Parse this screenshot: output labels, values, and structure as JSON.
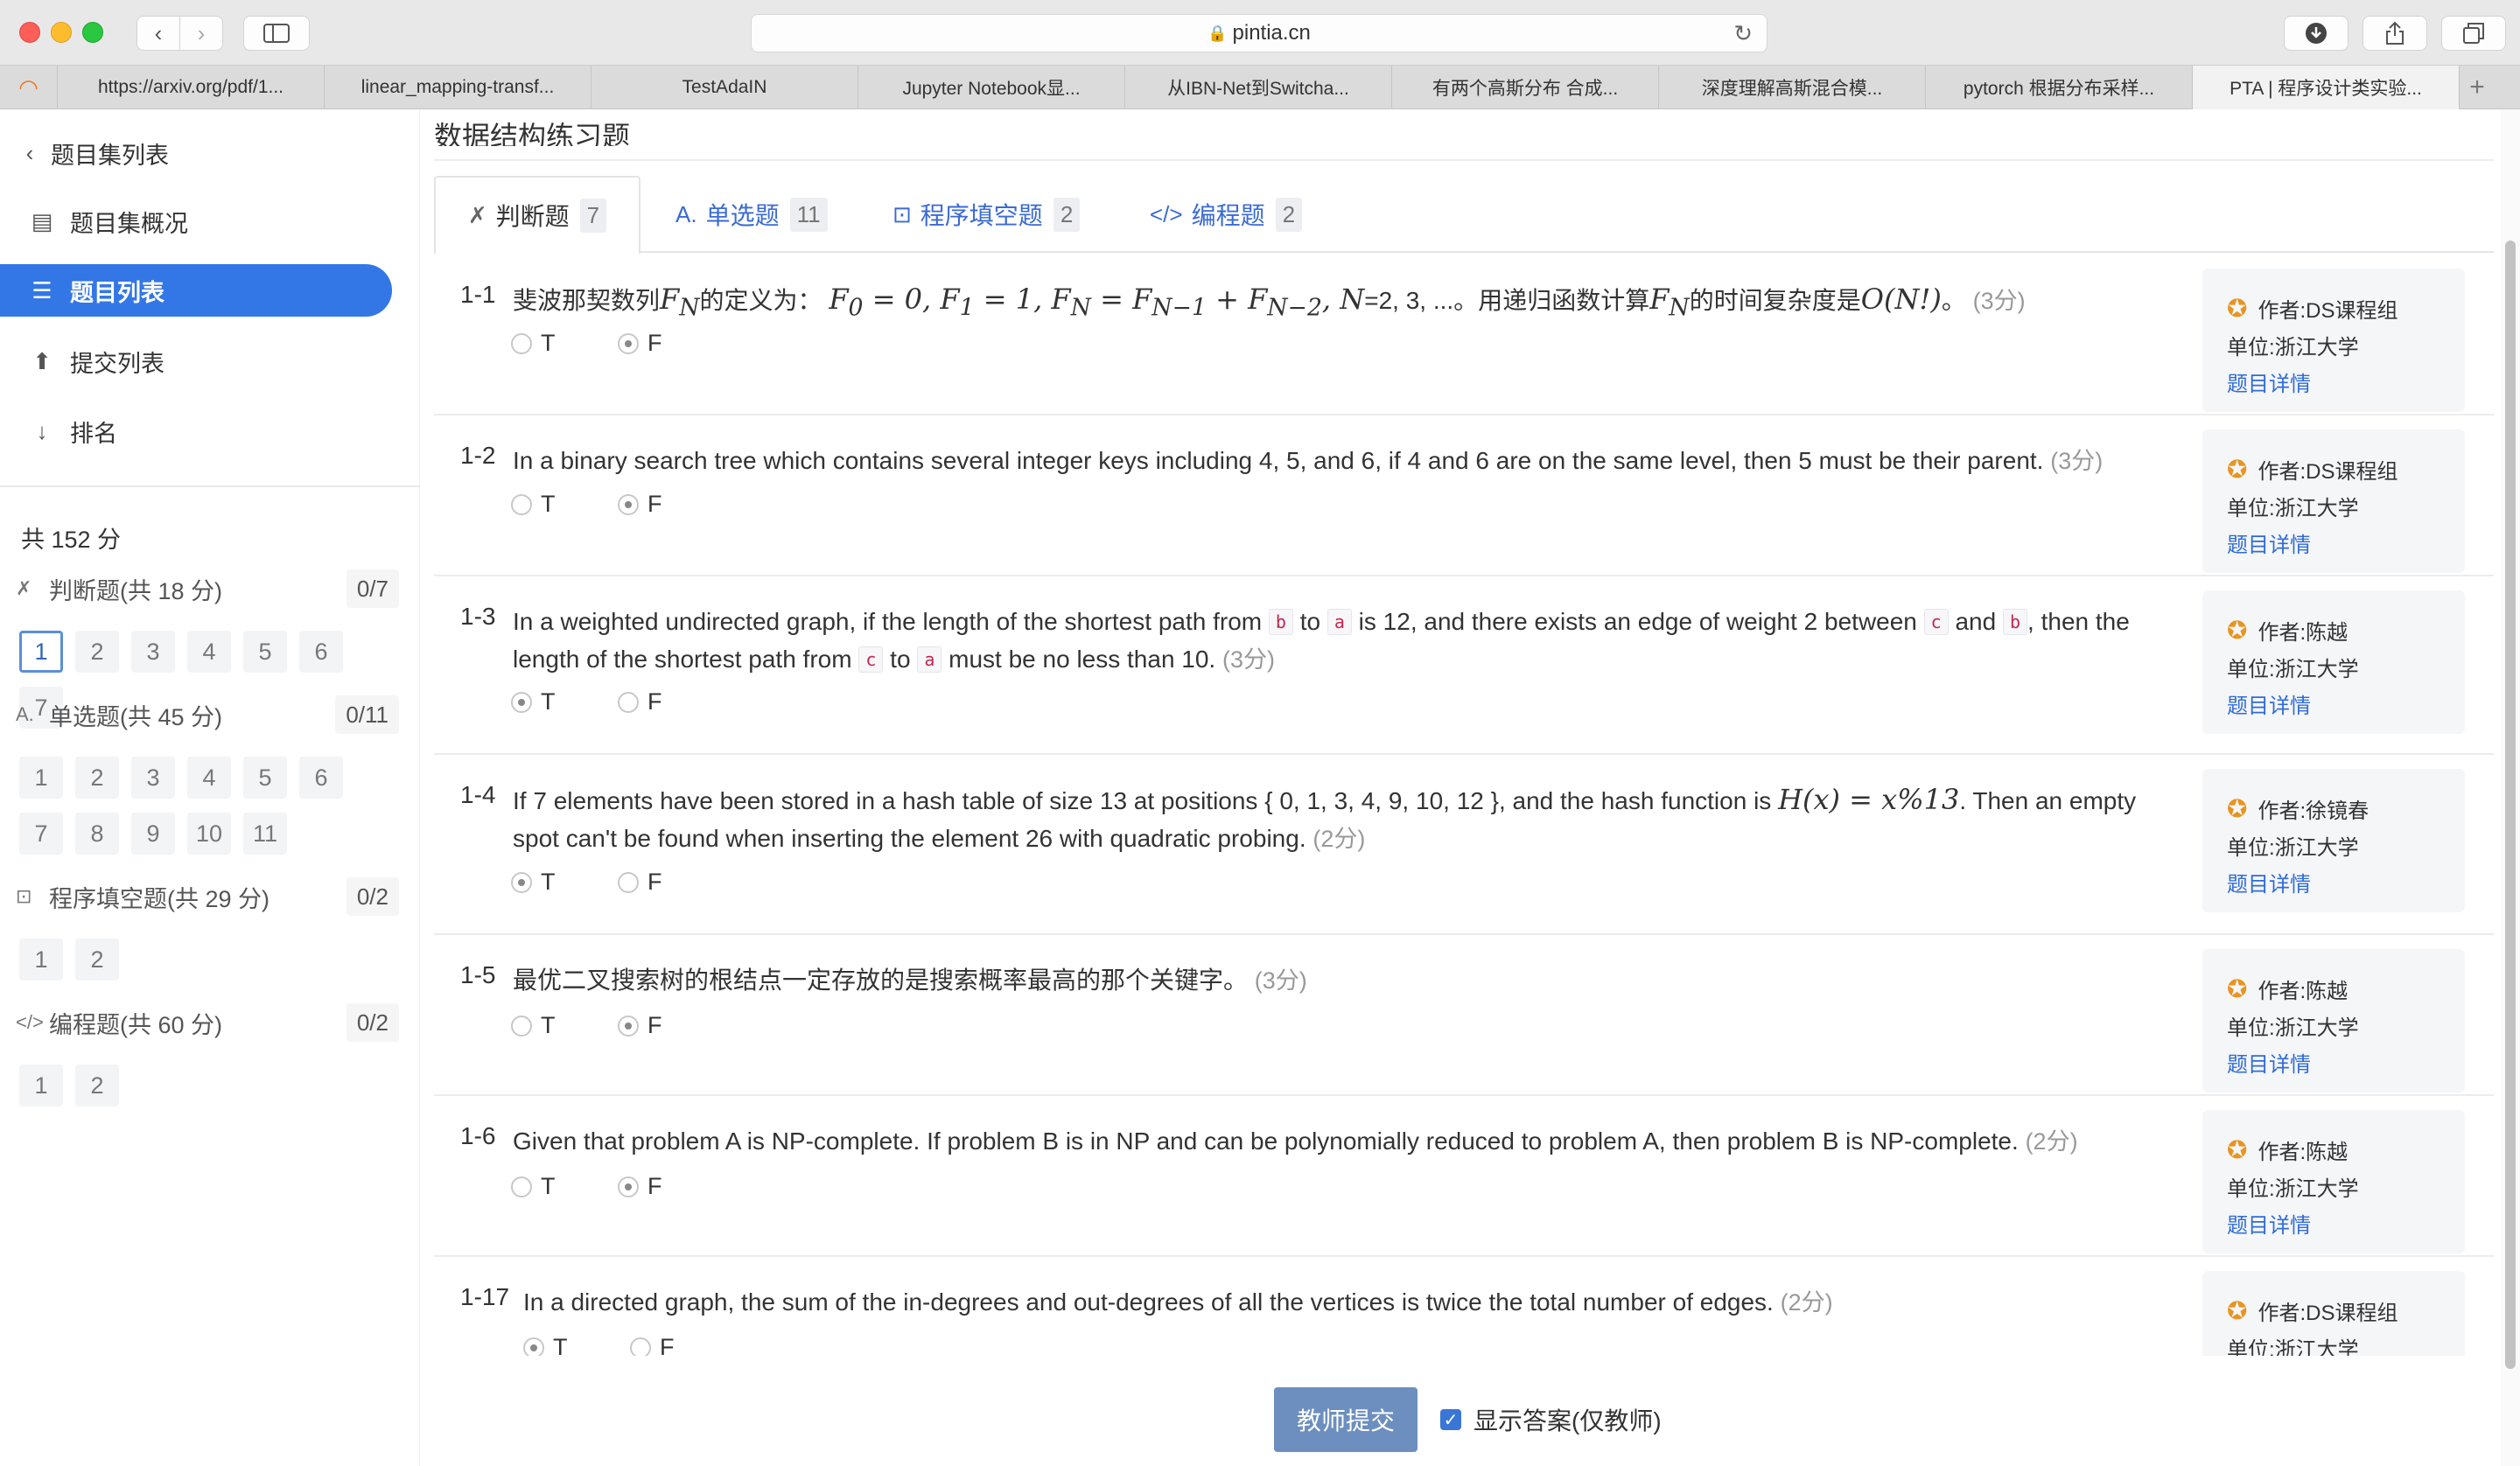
{
  "browser": {
    "url": "pintia.cn",
    "tabs": [
      {
        "label": "https://arxiv.org/pdf/1..."
      },
      {
        "label": "linear_mapping-transf..."
      },
      {
        "label": "TestAdaIN"
      },
      {
        "label": "Jupyter Notebook显..."
      },
      {
        "label": "从IBN-Net到Switcha..."
      },
      {
        "label": "有两个高斯分布 合成..."
      },
      {
        "label": "深度理解高斯混合模..."
      },
      {
        "label": "pytorch 根据分布采样..."
      },
      {
        "label": "PTA | 程序设计类实验..."
      }
    ]
  },
  "sidebar": {
    "back_label": "题目集列表",
    "items": [
      {
        "label": "题目集概况",
        "icon": "doc-icon"
      },
      {
        "label": "题目列表",
        "icon": "list-icon",
        "active": true
      },
      {
        "label": "提交列表",
        "icon": "upload-icon"
      },
      {
        "label": "排名",
        "icon": "sort-icon"
      }
    ],
    "total": "共 152 分",
    "sections": [
      {
        "label": "判断题(共 18 分)",
        "score": "0/7",
        "icon": "judge-icon",
        "questions": [
          "1",
          "2",
          "3",
          "4",
          "5",
          "6",
          "7"
        ]
      },
      {
        "label": "单选题(共 45 分)",
        "score": "0/11",
        "icon": "choice-icon",
        "questions": [
          "1",
          "2",
          "3",
          "4",
          "5",
          "6",
          "7",
          "8",
          "9",
          "10",
          "11"
        ]
      },
      {
        "label": "程序填空题(共 29 分)",
        "score": "0/2",
        "icon": "fill-icon",
        "questions": [
          "1",
          "2"
        ]
      },
      {
        "label": "编程题(共 60 分)",
        "score": "0/2",
        "icon": "code-icon",
        "questions": [
          "1",
          "2"
        ]
      }
    ]
  },
  "main": {
    "title": "数据结构练习题",
    "tabs": [
      {
        "label": "判断题",
        "count": "7"
      },
      {
        "label": "单选题",
        "count": "11"
      },
      {
        "label": "程序填空题",
        "count": "2"
      },
      {
        "label": "编程题",
        "count": "2"
      }
    ],
    "author_label": "作者: ",
    "unit_label": "单位: ",
    "detail_label": "题目详情",
    "questions": [
      {
        "num": "1-1",
        "points": "(3分)",
        "answer": "F",
        "author": "DS课程组",
        "unit": "浙江大学"
      },
      {
        "num": "1-2",
        "text": "In a binary search tree which contains several integer keys including 4, 5, and 6, if 4 and 6 are on the same level, then 5 must be their parent.",
        "points": "(3分)",
        "answer": "F",
        "author": "DS课程组",
        "unit": "浙江大学"
      },
      {
        "num": "1-3",
        "points": "(3分)",
        "answer": "T",
        "author": "陈越",
        "unit": "浙江大学"
      },
      {
        "num": "1-4",
        "points": "(2分)",
        "answer": "T",
        "author": "徐镜春",
        "unit": "浙江大学"
      },
      {
        "num": "1-5",
        "text": "最优二叉搜索树的根结点一定存放的是搜索概率最高的那个关键字。",
        "points": "(3分)",
        "answer": "F",
        "author": "陈越",
        "unit": "浙江大学"
      },
      {
        "num": "1-6",
        "text": "Given that problem A is NP-complete. If problem B is in NP and can be polynomially reduced to problem A, then problem B is NP-complete.",
        "points": "(2分)",
        "answer": "F",
        "author": "陈越",
        "unit": "浙江大学"
      },
      {
        "num": "1-17",
        "text": "In a directed graph, the sum of the in-degrees and out-degrees of all the vertices is twice the total number of edges.",
        "points": "(2分)",
        "answer": "T",
        "author": "DS课程组",
        "unit": "浙江大学"
      }
    ],
    "q1_parts": {
      "p1": "斐波那契数列",
      "p2": "的定义为：",
      "p3": "=2, 3, ...。用递归函数计算",
      "p4": "的时间复杂度是",
      "p5": "。"
    },
    "q3_parts": {
      "p1": "In a weighted undirected graph, if the length of the shortest path from",
      "c_b": "b",
      "to": "to",
      "c_a": "a",
      "p2": "is 12, and there exists an edge of weight 2 between",
      "c_c": "c",
      "and": "and",
      "p3": "then the length of the shortest path from",
      "p4": "must be no less than 10."
    },
    "q4_parts": {
      "p1": "If 7 elements have been stored in a hash table of size 13 at positions { 0, 1, 3, 4, 9, 10, 12 }, and the hash function is",
      "p2": ". Then an empty spot can't be found when inserting the element 26 with quadratic probing."
    },
    "options": [
      "T",
      "F"
    ]
  },
  "footer": {
    "submit_label": "教师提交",
    "show_answer_label": "显示答案(仅教师)"
  }
}
